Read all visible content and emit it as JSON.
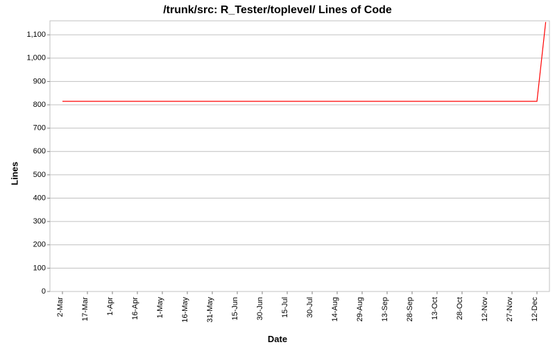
{
  "chart_data": {
    "type": "line",
    "title": "/trunk/src: R_Tester/toplevel/ Lines of Code",
    "xlabel": "Date",
    "ylabel": "Lines",
    "x_categories": [
      "2-Mar",
      "17-Mar",
      "1-Apr",
      "16-Apr",
      "1-May",
      "16-May",
      "31-May",
      "15-Jun",
      "30-Jun",
      "15-Jul",
      "30-Jul",
      "14-Aug",
      "29-Aug",
      "13-Sep",
      "28-Sep",
      "13-Oct",
      "28-Oct",
      "12-Nov",
      "27-Nov",
      "12-Dec"
    ],
    "y_ticks": [
      0,
      100,
      200,
      300,
      400,
      500,
      600,
      700,
      800,
      900,
      1000,
      1100
    ],
    "ylim": [
      0,
      1160
    ],
    "series": [
      {
        "name": "Lines of Code",
        "color": "#ff0000",
        "values": [
          815,
          815,
          815,
          815,
          815,
          815,
          815,
          815,
          815,
          815,
          815,
          815,
          815,
          815,
          815,
          815,
          815,
          815,
          815,
          815,
          1155
        ]
      }
    ],
    "note": "Final rise occurs just after 12-Dec"
  }
}
